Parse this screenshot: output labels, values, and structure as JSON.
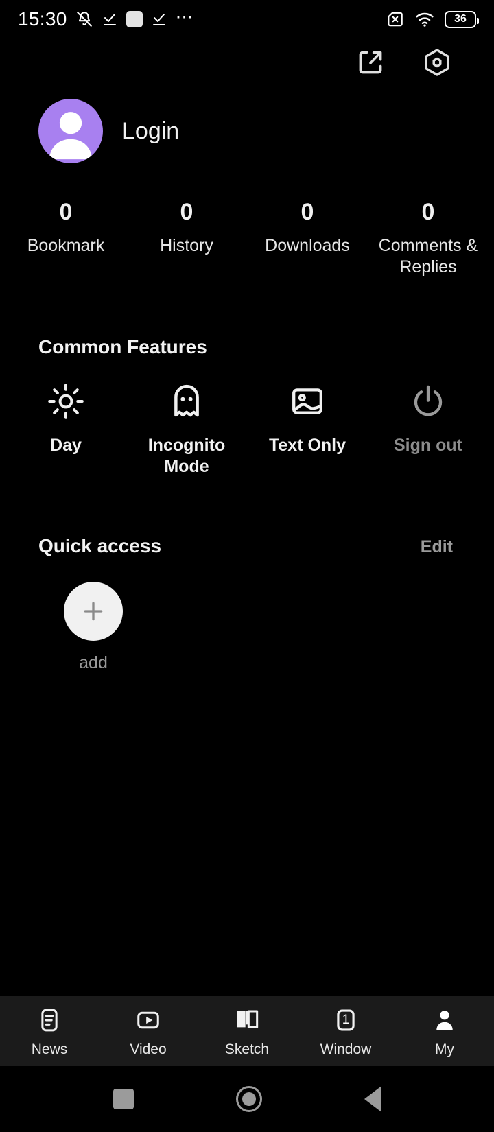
{
  "status_bar": {
    "clock": "15:30",
    "battery_level": "36",
    "icons": [
      "bell-muted-icon",
      "check-underline-icon",
      "rounded-square-icon",
      "check-underline-icon",
      "ellipsis-icon",
      "sim-card-off-icon",
      "wifi-icon",
      "battery-icon"
    ]
  },
  "toolbar": {
    "share_label": "share-icon",
    "settings_label": "settings-hex-icon"
  },
  "profile": {
    "login_label": "Login",
    "avatar_color": "#a880f0"
  },
  "stats": [
    {
      "value": "0",
      "label": "Bookmark"
    },
    {
      "value": "0",
      "label": "History"
    },
    {
      "value": "0",
      "label": "Downloads"
    },
    {
      "value": "0",
      "label": "Comments & Replies"
    }
  ],
  "common_features": {
    "title": "Common Features",
    "items": [
      {
        "label": "Day",
        "icon": "sun-icon",
        "dim": false
      },
      {
        "label": "Incognito Mode",
        "icon": "ghost-icon",
        "dim": false
      },
      {
        "label": "Text Only",
        "icon": "image-icon",
        "dim": false
      },
      {
        "label": "Sign out",
        "icon": "power-icon",
        "dim": true
      }
    ]
  },
  "quick_access": {
    "title": "Quick access",
    "edit_label": "Edit",
    "items": [
      {
        "label": "add",
        "icon": "plus-icon"
      }
    ]
  },
  "bottom_nav": {
    "items": [
      {
        "label": "News",
        "icon": "news-document-icon",
        "active": false
      },
      {
        "label": "Video",
        "icon": "video-play-icon",
        "active": false
      },
      {
        "label": "Sketch",
        "icon": "open-book-icon",
        "active": false
      },
      {
        "label": "Window",
        "icon": "window-count-icon",
        "badge": "1",
        "active": false
      },
      {
        "label": "My",
        "icon": "person-icon",
        "active": true
      }
    ]
  },
  "system_bar": {
    "recents": "recents-square-icon",
    "home": "home-circle-icon",
    "back": "back-triangle-icon"
  }
}
